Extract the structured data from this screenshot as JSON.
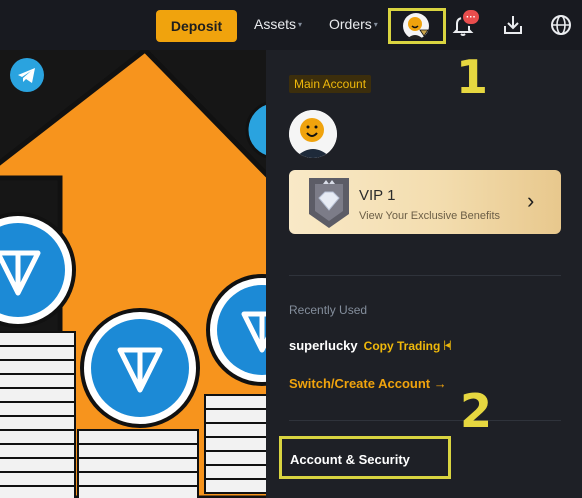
{
  "nav": {
    "deposit_label": "Deposit",
    "assets_label": "Assets",
    "orders_label": "Orders",
    "notification_badge": "···",
    "caret": "▾"
  },
  "panel": {
    "account_type": "Main Account",
    "vip": {
      "title": "VIP 1",
      "subtitle": "View Your Exclusive Benefits",
      "chevron": "›"
    },
    "recently_used_label": "Recently Used",
    "recent_account": {
      "name": "superlucky",
      "tag": "Copy Trading",
      "tag_icon": "|◂|"
    },
    "switch_label": "Switch/Create Account →",
    "account_security_label": "Account & Security"
  },
  "annotations": {
    "step1": "1",
    "step2": "2"
  },
  "colors": {
    "accent": "#f0a30d",
    "highlight": "#d9d440",
    "panel_bg": "#1e2026",
    "ton_blue": "#1c8ad6",
    "banner_orange": "#f7941d"
  }
}
